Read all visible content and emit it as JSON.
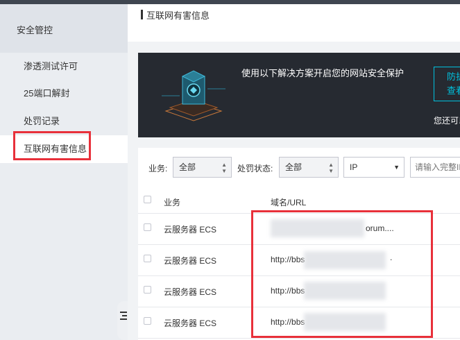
{
  "sidebar": {
    "title": "安全管控",
    "items": [
      {
        "label": "渗透测试许可"
      },
      {
        "label": "25端口解封"
      },
      {
        "label": "处罚记录"
      },
      {
        "label": "互联网有害信息"
      }
    ]
  },
  "header": {
    "title": "互联网有害信息"
  },
  "banner": {
    "text": "使用以下解决方案开启您的网站安全保护",
    "button_label": "防护\n查看",
    "note": "您还可以"
  },
  "filters": {
    "business_label": "业务:",
    "business_value": "全部",
    "status_label": "处罚状态:",
    "status_value": "全部",
    "type_value": "IP",
    "search_placeholder": "请输入完整IP"
  },
  "table": {
    "columns": [
      "业务",
      "域名/URL"
    ],
    "rows": [
      {
        "business": "云服务器 ECS",
        "url": "orum...."
      },
      {
        "business": "云服务器 ECS",
        "url": "http://bbs",
        "tail": "."
      },
      {
        "business": "云服务器 ECS",
        "url": "http://bbs"
      },
      {
        "business": "云服务器 ECS",
        "url": "http://bbs"
      }
    ]
  },
  "colors": {
    "accent": "#00c1de",
    "highlight": "#e8303a",
    "banner_bg": "#262a31"
  }
}
